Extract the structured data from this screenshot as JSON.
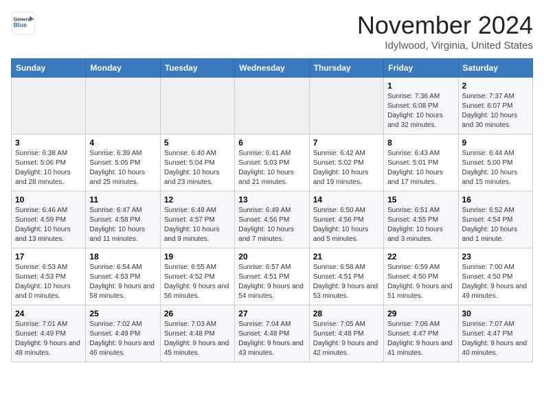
{
  "header": {
    "logo": {
      "line1": "General",
      "line2": "Blue"
    },
    "title": "November 2024",
    "location": "Idylwood, Virginia, United States"
  },
  "calendar": {
    "days_of_week": [
      "Sunday",
      "Monday",
      "Tuesday",
      "Wednesday",
      "Thursday",
      "Friday",
      "Saturday"
    ],
    "weeks": [
      [
        {
          "day": "",
          "info": ""
        },
        {
          "day": "",
          "info": ""
        },
        {
          "day": "",
          "info": ""
        },
        {
          "day": "",
          "info": ""
        },
        {
          "day": "",
          "info": ""
        },
        {
          "day": "1",
          "info": "Sunrise: 7:36 AM\nSunset: 6:08 PM\nDaylight: 10 hours and 32 minutes."
        },
        {
          "day": "2",
          "info": "Sunrise: 7:37 AM\nSunset: 6:07 PM\nDaylight: 10 hours and 30 minutes."
        }
      ],
      [
        {
          "day": "3",
          "info": "Sunrise: 6:38 AM\nSunset: 5:06 PM\nDaylight: 10 hours and 28 minutes."
        },
        {
          "day": "4",
          "info": "Sunrise: 6:39 AM\nSunset: 5:05 PM\nDaylight: 10 hours and 25 minutes."
        },
        {
          "day": "5",
          "info": "Sunrise: 6:40 AM\nSunset: 5:04 PM\nDaylight: 10 hours and 23 minutes."
        },
        {
          "day": "6",
          "info": "Sunrise: 6:41 AM\nSunset: 5:03 PM\nDaylight: 10 hours and 21 minutes."
        },
        {
          "day": "7",
          "info": "Sunrise: 6:42 AM\nSunset: 5:02 PM\nDaylight: 10 hours and 19 minutes."
        },
        {
          "day": "8",
          "info": "Sunrise: 6:43 AM\nSunset: 5:01 PM\nDaylight: 10 hours and 17 minutes."
        },
        {
          "day": "9",
          "info": "Sunrise: 6:44 AM\nSunset: 5:00 PM\nDaylight: 10 hours and 15 minutes."
        }
      ],
      [
        {
          "day": "10",
          "info": "Sunrise: 6:46 AM\nSunset: 4:59 PM\nDaylight: 10 hours and 13 minutes."
        },
        {
          "day": "11",
          "info": "Sunrise: 6:47 AM\nSunset: 4:58 PM\nDaylight: 10 hours and 11 minutes."
        },
        {
          "day": "12",
          "info": "Sunrise: 6:48 AM\nSunset: 4:57 PM\nDaylight: 10 hours and 9 minutes."
        },
        {
          "day": "13",
          "info": "Sunrise: 6:49 AM\nSunset: 4:56 PM\nDaylight: 10 hours and 7 minutes."
        },
        {
          "day": "14",
          "info": "Sunrise: 6:50 AM\nSunset: 4:56 PM\nDaylight: 10 hours and 5 minutes."
        },
        {
          "day": "15",
          "info": "Sunrise: 6:51 AM\nSunset: 4:55 PM\nDaylight: 10 hours and 3 minutes."
        },
        {
          "day": "16",
          "info": "Sunrise: 6:52 AM\nSunset: 4:54 PM\nDaylight: 10 hours and 1 minute."
        }
      ],
      [
        {
          "day": "17",
          "info": "Sunrise: 6:53 AM\nSunset: 4:53 PM\nDaylight: 10 hours and 0 minutes."
        },
        {
          "day": "18",
          "info": "Sunrise: 6:54 AM\nSunset: 4:53 PM\nDaylight: 9 hours and 58 minutes."
        },
        {
          "day": "19",
          "info": "Sunrise: 6:55 AM\nSunset: 4:52 PM\nDaylight: 9 hours and 56 minutes."
        },
        {
          "day": "20",
          "info": "Sunrise: 6:57 AM\nSunset: 4:51 PM\nDaylight: 9 hours and 54 minutes."
        },
        {
          "day": "21",
          "info": "Sunrise: 6:58 AM\nSunset: 4:51 PM\nDaylight: 9 hours and 53 minutes."
        },
        {
          "day": "22",
          "info": "Sunrise: 6:59 AM\nSunset: 4:50 PM\nDaylight: 9 hours and 51 minutes."
        },
        {
          "day": "23",
          "info": "Sunrise: 7:00 AM\nSunset: 4:50 PM\nDaylight: 9 hours and 49 minutes."
        }
      ],
      [
        {
          "day": "24",
          "info": "Sunrise: 7:01 AM\nSunset: 4:49 PM\nDaylight: 9 hours and 48 minutes."
        },
        {
          "day": "25",
          "info": "Sunrise: 7:02 AM\nSunset: 4:49 PM\nDaylight: 9 hours and 46 minutes."
        },
        {
          "day": "26",
          "info": "Sunrise: 7:03 AM\nSunset: 4:48 PM\nDaylight: 9 hours and 45 minutes."
        },
        {
          "day": "27",
          "info": "Sunrise: 7:04 AM\nSunset: 4:48 PM\nDaylight: 9 hours and 43 minutes."
        },
        {
          "day": "28",
          "info": "Sunrise: 7:05 AM\nSunset: 4:48 PM\nDaylight: 9 hours and 42 minutes."
        },
        {
          "day": "29",
          "info": "Sunrise: 7:06 AM\nSunset: 4:47 PM\nDaylight: 9 hours and 41 minutes."
        },
        {
          "day": "30",
          "info": "Sunrise: 7:07 AM\nSunset: 4:47 PM\nDaylight: 9 hours and 40 minutes."
        }
      ]
    ]
  }
}
